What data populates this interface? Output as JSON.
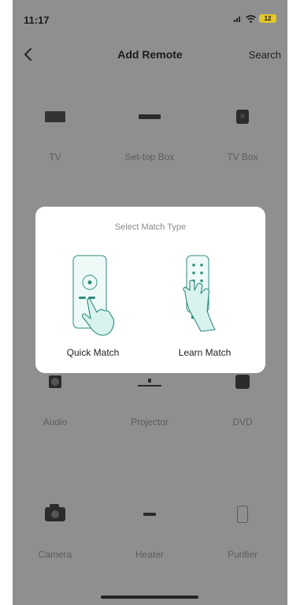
{
  "status_bar": {
    "time": "11:17",
    "battery": "12"
  },
  "nav": {
    "title": "Add Remote",
    "search": "Search"
  },
  "devices": {
    "tv": "TV",
    "set_top_box": "Set-top Box",
    "tv_box": "TV Box",
    "audio": "Audio",
    "projector": "Projector",
    "dvd": "DVD",
    "camera": "Camera",
    "heater": "Heater",
    "purifier": "Purifier"
  },
  "dialog": {
    "title": "Select Match Type",
    "options": [
      {
        "label": "Quick Match",
        "icon": "remote-touch-icon"
      },
      {
        "label": "Learn Match",
        "icon": "remote-hold-icon"
      }
    ]
  },
  "colors": {
    "overlay_background": "#8f8f8f",
    "dialog_background": "#ffffff",
    "illustration_accent": "#d8f2ee",
    "illustration_line": "#2f8a7c",
    "battery": "#e2c62c"
  }
}
